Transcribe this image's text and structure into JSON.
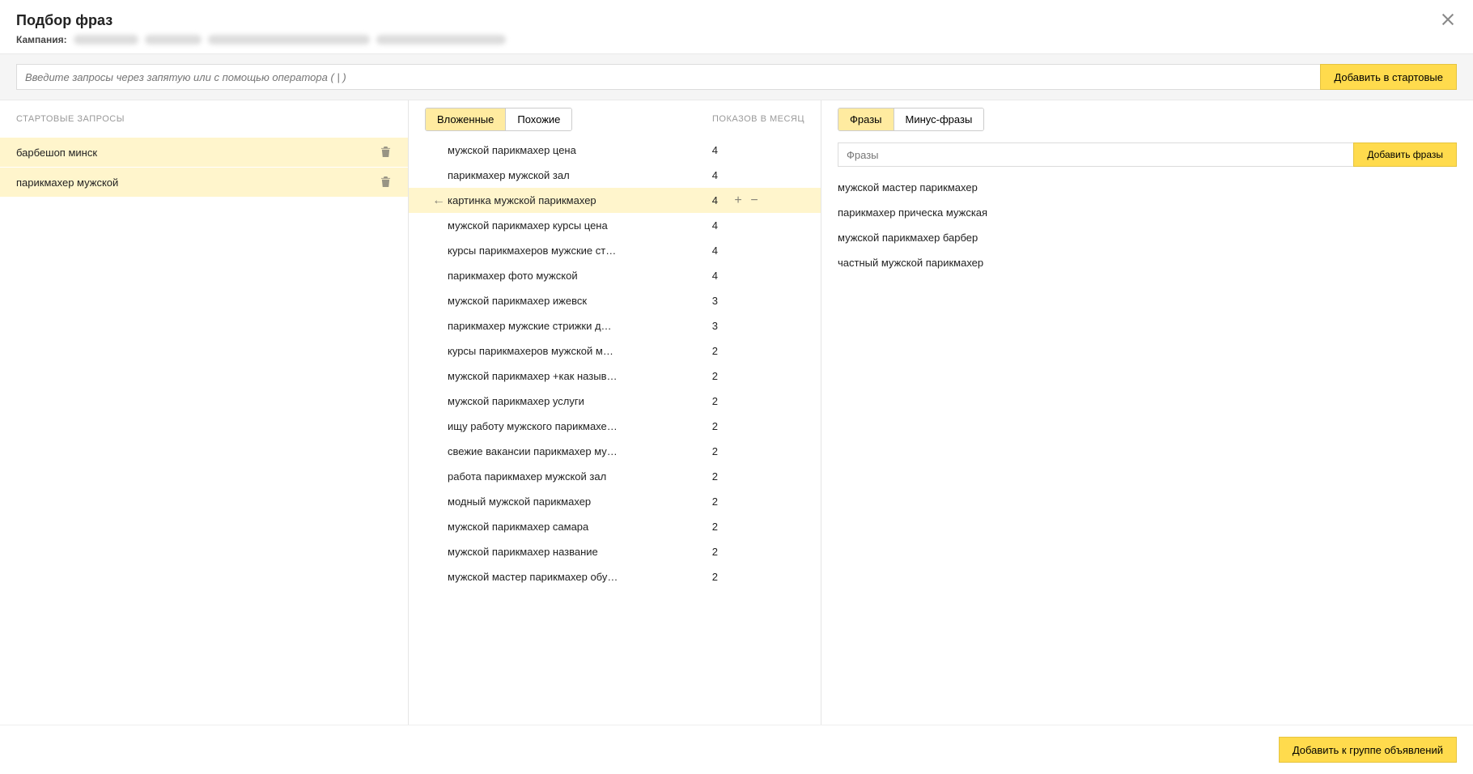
{
  "header": {
    "title": "Подбор фраз",
    "campaign_label": "Кампания:"
  },
  "search": {
    "placeholder": "Введите запросы через запятую или с помощью оператора ( | )",
    "add_button": "Добавить в стартовые"
  },
  "left": {
    "heading": "СТАРТОВЫЕ ЗАПРОСЫ",
    "items": [
      {
        "text": "барбешоп минск"
      },
      {
        "text": "парикмахер мужской"
      }
    ]
  },
  "mid": {
    "tab_nested": "Вложенные",
    "tab_similar": "Похожие",
    "impressions_label": "ПОКАЗОВ В МЕСЯЦ",
    "rows": [
      {
        "text": "мужской парикмахер цена",
        "count": "4",
        "hl": false
      },
      {
        "text": "парикмахер мужской зал",
        "count": "4",
        "hl": false
      },
      {
        "text": "картинка мужской парикмахер",
        "count": "4",
        "hl": true
      },
      {
        "text": "мужской парикмахер курсы цена",
        "count": "4",
        "hl": false
      },
      {
        "text": "курсы парикмахеров мужские ст…",
        "count": "4",
        "hl": false
      },
      {
        "text": "парикмахер фото мужской",
        "count": "4",
        "hl": false
      },
      {
        "text": "мужской парикмахер ижевск",
        "count": "3",
        "hl": false
      },
      {
        "text": "парикмахер мужские стрижки д…",
        "count": "3",
        "hl": false
      },
      {
        "text": "курсы парикмахеров мужской м…",
        "count": "2",
        "hl": false
      },
      {
        "text": "мужской парикмахер +как назыв…",
        "count": "2",
        "hl": false
      },
      {
        "text": "мужской парикмахер услуги",
        "count": "2",
        "hl": false
      },
      {
        "text": "ищу работу мужского парикмахе…",
        "count": "2",
        "hl": false
      },
      {
        "text": "свежие вакансии парикмахер му…",
        "count": "2",
        "hl": false
      },
      {
        "text": "работа парикмахер мужской зал",
        "count": "2",
        "hl": false
      },
      {
        "text": "модный мужской парикмахер",
        "count": "2",
        "hl": false
      },
      {
        "text": "мужской парикмахер самара",
        "count": "2",
        "hl": false
      },
      {
        "text": "мужской парикмахер название",
        "count": "2",
        "hl": false
      },
      {
        "text": "мужской мастер парикмахер обу…",
        "count": "2",
        "hl": false
      }
    ]
  },
  "right": {
    "tab_phrases": "Фразы",
    "tab_minus": "Минус-фразы",
    "input_placeholder": "Фразы",
    "add_button": "Добавить фразы",
    "items": [
      "мужской мастер парикмахер",
      "парикмахер прическа мужская",
      "мужской парикмахер барбер",
      "частный мужской парикмахер"
    ]
  },
  "footer": {
    "add_to_group": "Добавить к группе объявлений"
  }
}
